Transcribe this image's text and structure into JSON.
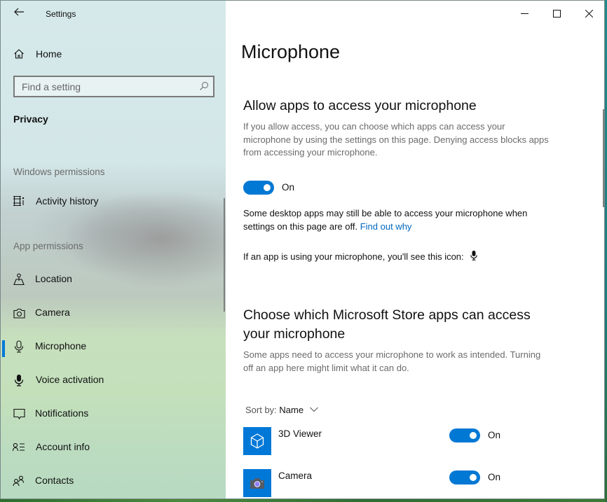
{
  "window": {
    "title": "Settings",
    "caption_buttons": {
      "minimize": "minimize",
      "maximize": "maximize",
      "close": "close"
    }
  },
  "sidebar": {
    "back_icon": "back-arrow-icon",
    "home": {
      "label": "Home",
      "icon": "home-icon"
    },
    "search": {
      "placeholder": "Find a setting",
      "value": "",
      "icon": "search-icon"
    },
    "category": "Privacy",
    "sections": [
      {
        "heading": "Windows permissions",
        "items": [
          {
            "label": "Activity history",
            "icon": "activity-history-icon"
          }
        ]
      },
      {
        "heading": "App permissions",
        "items": [
          {
            "label": "Location",
            "icon": "location-icon"
          },
          {
            "label": "Camera",
            "icon": "camera-icon"
          },
          {
            "label": "Microphone",
            "icon": "microphone-icon",
            "active": true
          },
          {
            "label": "Voice activation",
            "icon": "voice-activation-icon"
          },
          {
            "label": "Notifications",
            "icon": "notifications-icon"
          },
          {
            "label": "Account info",
            "icon": "account-info-icon"
          },
          {
            "label": "Contacts",
            "icon": "contacts-icon"
          }
        ]
      }
    ]
  },
  "main": {
    "title": "Microphone",
    "allow_section": {
      "heading": "Allow apps to access your microphone",
      "description": "If you allow access, you can choose which apps can access your microphone by using the settings on this page. Denying access blocks apps from accessing your microphone.",
      "toggle": {
        "state": "on",
        "label": "On"
      }
    },
    "desktop_note": {
      "text": "Some desktop apps may still be able to access your microphone when settings on this page are off.",
      "link": "Find out why"
    },
    "icon_note": {
      "text": "If an app is using your microphone, you'll see this icon:",
      "icon": "microphone-filled-icon"
    },
    "store_section": {
      "heading": "Choose which Microsoft Store apps can access your microphone",
      "description": "Some apps need to access your microphone to work as intended. Turning off an app here might limit what it can do.",
      "sort": {
        "label": "Sort by:",
        "value": "Name"
      },
      "apps": [
        {
          "name": "3D Viewer",
          "icon": "3d-viewer-icon",
          "toggle": {
            "state": "on",
            "label": "On"
          }
        },
        {
          "name": "Camera",
          "icon": "camera-app-icon",
          "toggle": {
            "state": "on",
            "label": "On"
          }
        }
      ]
    }
  },
  "colors": {
    "accent": "#0078d4",
    "link": "#0067c0"
  }
}
